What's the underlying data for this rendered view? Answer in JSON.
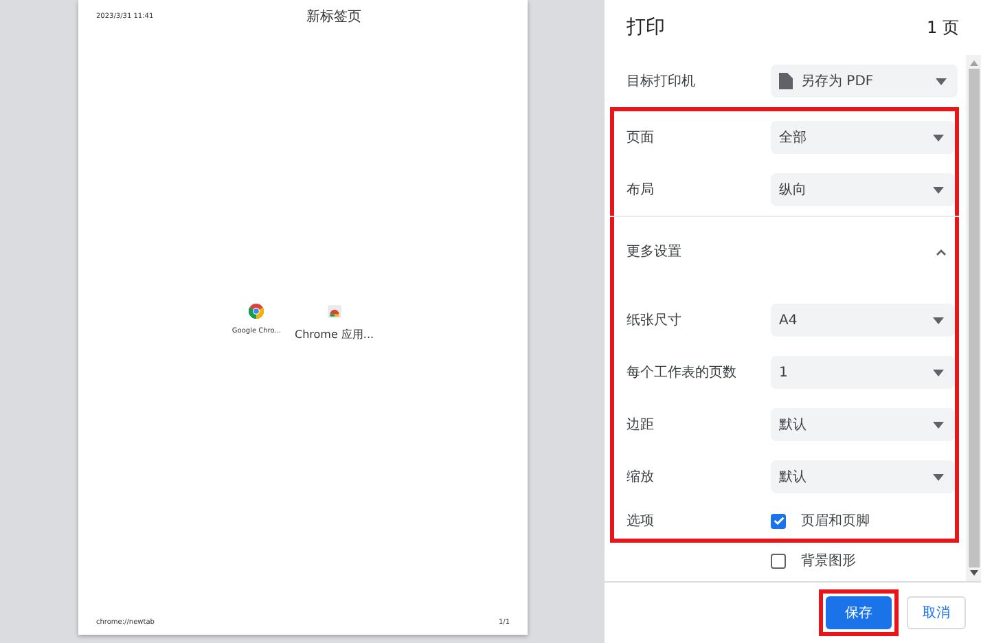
{
  "preview": {
    "header_left": "2023/3/31 11:41",
    "header_title": "新标签页",
    "apps": [
      {
        "kind": "chrome",
        "label": "Google Chro..."
      },
      {
        "kind": "store",
        "label": "Chrome 应用..."
      }
    ],
    "footer_left": "chrome://newtab",
    "footer_right": "1/1"
  },
  "panel": {
    "title": "打印",
    "page_count": "1 页",
    "destination": {
      "label": "目标打印机",
      "value": "另存为 PDF"
    },
    "main_settings": [
      {
        "label": "页面",
        "value": "全部"
      },
      {
        "label": "布局",
        "value": "纵向"
      }
    ],
    "more_settings": {
      "label": "更多设置",
      "expanded": true
    },
    "extra_settings": [
      {
        "label": "纸张尺寸",
        "value": "A4"
      },
      {
        "label": "每个工作表的页数",
        "value": "1"
      },
      {
        "label": "边距",
        "value": "默认"
      },
      {
        "label": "缩放",
        "value": "默认"
      }
    ],
    "options": {
      "label": "选项",
      "checkboxes": [
        {
          "label": "页眉和页脚",
          "checked": true
        },
        {
          "label": "背景图形",
          "checked": false
        }
      ]
    },
    "buttons": [
      {
        "label": "保存",
        "kind": "primary"
      },
      {
        "label": "取消",
        "kind": "secondary"
      }
    ]
  }
}
